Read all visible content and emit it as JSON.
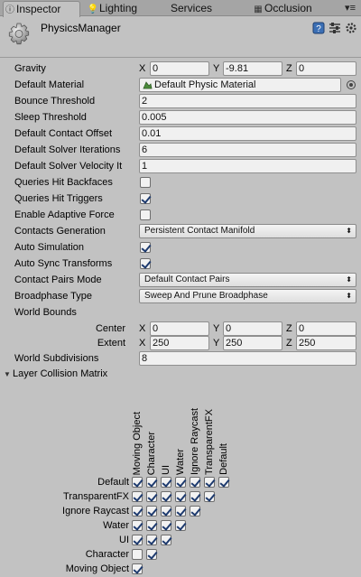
{
  "tabs": [
    {
      "label": "Inspector",
      "icon": "info-icon",
      "active": true
    },
    {
      "label": "Lighting",
      "icon": "lightbulb-icon",
      "active": false
    },
    {
      "label": "Services",
      "icon": "",
      "active": false
    },
    {
      "label": "Occlusion",
      "icon": "occlusion-icon",
      "active": false
    }
  ],
  "tab_menu": "▾≡",
  "header": {
    "title": "PhysicsManager"
  },
  "gravity": {
    "label": "Gravity",
    "x_axis": "X",
    "x": "0",
    "y_axis": "Y",
    "y": "-9.81",
    "z_axis": "Z",
    "z": "0"
  },
  "default_material": {
    "label": "Default Material",
    "value": "Default Physic Material"
  },
  "bounce_threshold": {
    "label": "Bounce Threshold",
    "value": "2"
  },
  "sleep_threshold": {
    "label": "Sleep Threshold",
    "value": "0.005"
  },
  "default_contact_offset": {
    "label": "Default Contact Offset",
    "value": "0.01"
  },
  "default_solver_iterations": {
    "label": "Default Solver Iterations",
    "value": "6"
  },
  "default_solver_velocity": {
    "label": "Default Solver Velocity It",
    "value": "1"
  },
  "queries_hit_backfaces": {
    "label": "Queries Hit Backfaces",
    "checked": false
  },
  "queries_hit_triggers": {
    "label": "Queries Hit Triggers",
    "checked": true
  },
  "enable_adaptive_force": {
    "label": "Enable Adaptive Force",
    "checked": false
  },
  "contacts_generation": {
    "label": "Contacts Generation",
    "value": "Persistent Contact Manifold"
  },
  "auto_simulation": {
    "label": "Auto Simulation",
    "checked": true
  },
  "auto_sync_transforms": {
    "label": "Auto Sync Transforms",
    "checked": true
  },
  "contact_pairs_mode": {
    "label": "Contact Pairs Mode",
    "value": "Default Contact Pairs"
  },
  "broadphase_type": {
    "label": "Broadphase Type",
    "value": "Sweep And Prune Broadphase"
  },
  "world_bounds": {
    "label": "World Bounds",
    "center": {
      "label": "Center",
      "x": "0",
      "y": "0",
      "z": "0"
    },
    "extent": {
      "label": "Extent",
      "x": "250",
      "y": "250",
      "z": "250"
    }
  },
  "world_subdivisions": {
    "label": "World Subdivisions",
    "value": "8"
  },
  "matrix": {
    "label": "Layer Collision Matrix",
    "columns": [
      "Moving Object",
      "Character",
      "UI",
      "Water",
      "Ignore Raycast",
      "TransparentFX",
      "Default"
    ],
    "rows": [
      {
        "label": "Default",
        "checks": [
          true,
          true,
          true,
          true,
          true,
          true,
          true
        ]
      },
      {
        "label": "TransparentFX",
        "checks": [
          true,
          true,
          true,
          true,
          true,
          true
        ]
      },
      {
        "label": "Ignore Raycast",
        "checks": [
          true,
          true,
          true,
          true,
          true
        ]
      },
      {
        "label": "Water",
        "checks": [
          true,
          true,
          true,
          true
        ]
      },
      {
        "label": "UI",
        "checks": [
          true,
          true,
          true
        ]
      },
      {
        "label": "Character",
        "checks": [
          false,
          true
        ]
      },
      {
        "label": "Moving Object",
        "checks": [
          true
        ]
      }
    ]
  },
  "colors": {
    "panel": "#c2c2c2",
    "tabbar": "#a5a5a5",
    "field": "#f0f0f0",
    "check": "#1d3a6e"
  }
}
